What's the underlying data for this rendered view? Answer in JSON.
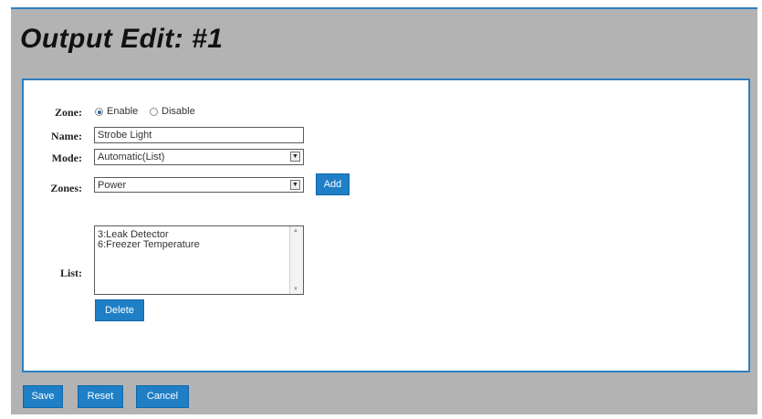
{
  "page": {
    "title": "Output Edit: #1"
  },
  "form": {
    "zone": {
      "label": "Zone:",
      "options": [
        "Enable",
        "Disable"
      ],
      "selected": "Enable"
    },
    "name": {
      "label": "Name:",
      "value": "Strobe Light"
    },
    "mode": {
      "label": "Mode:",
      "value": "Automatic(List)"
    },
    "zones": {
      "label": "Zones:",
      "value": "Power",
      "add_label": "Add"
    },
    "list": {
      "label": "List:",
      "items": [
        "3:Leak Detector",
        "6:Freezer Temperature"
      ],
      "delete_label": "Delete"
    }
  },
  "footer": {
    "save_label": "Save",
    "reset_label": "Reset",
    "cancel_label": "Cancel"
  },
  "colors": {
    "accent": "#1e7fc6",
    "frame": "#b3b3b3",
    "border": "#2f7fc1"
  }
}
